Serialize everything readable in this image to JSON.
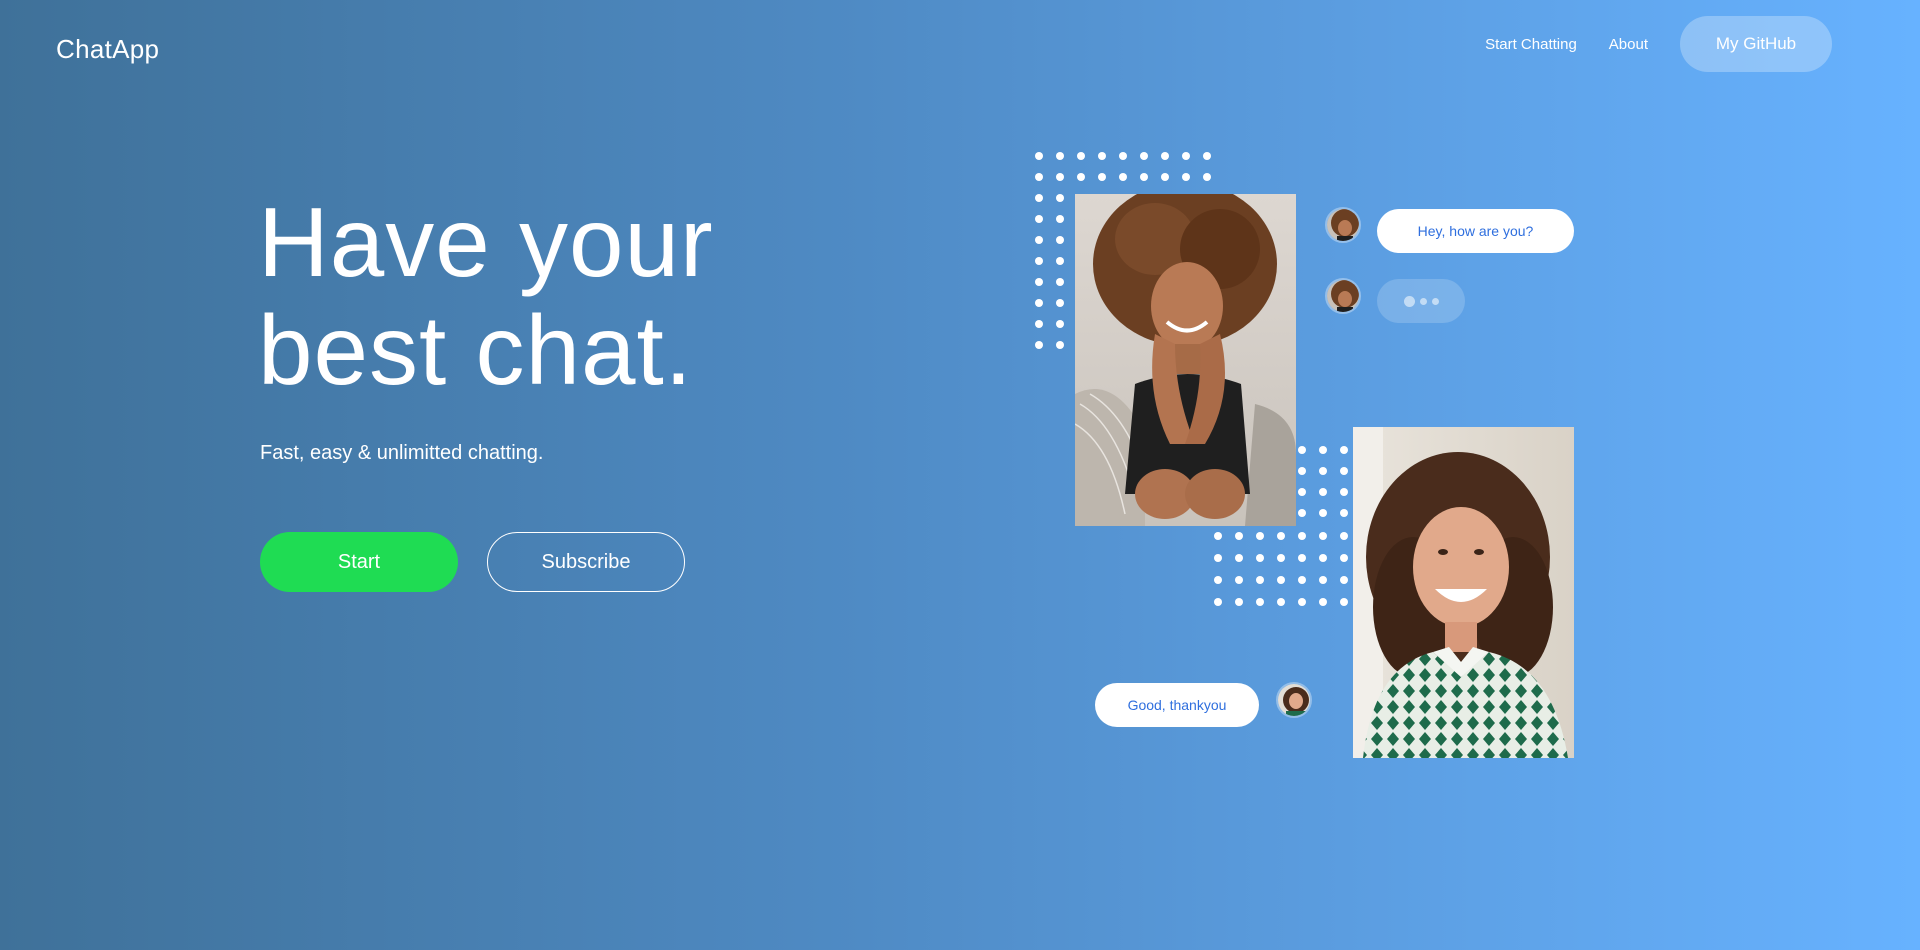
{
  "header": {
    "brand": "ChatApp",
    "nav": [
      {
        "label": "Start Chatting"
      },
      {
        "label": "About"
      }
    ],
    "github_button": "My GitHub"
  },
  "hero": {
    "title_line1": "Have your",
    "title_line2": "best chat.",
    "subtitle": "Fast, easy & unlimitted chatting.",
    "start_button": "Start",
    "subscribe_button": "Subscribe"
  },
  "chat": {
    "message_1": "Hey, how are you?",
    "message_2": "Good, thankyou"
  },
  "colors": {
    "start_green": "#1fdc53",
    "bubble_text": "#2f6fde"
  }
}
